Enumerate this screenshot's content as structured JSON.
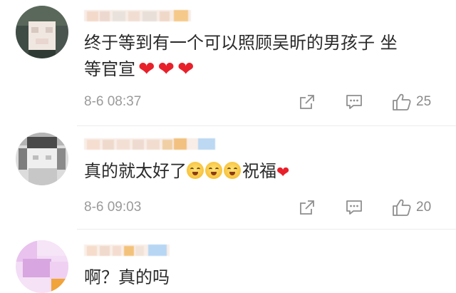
{
  "comments": [
    {
      "text_line1": "终于等到有一个可以照顾吴昕的男孩子 坐",
      "text_line2": "等官宣",
      "hearts": [
        "❤",
        "❤",
        "❤"
      ],
      "time": "8-6 08:37",
      "likes": "25",
      "avatar_colors": [
        "#5a6a5a",
        "#f1e8e2",
        "#3d4a44"
      ],
      "name_colors": [
        "#f3d9c9",
        "#e9e2dc",
        "#f5c98a"
      ]
    },
    {
      "text": "真的就太好了",
      "text_suffix": "祝福",
      "emoji_icons": [
        "grinning-sweat-emoji",
        "grinning-sweat-emoji",
        "grinning-sweat-emoji"
      ],
      "heart": "❤",
      "time": "8-6 09:03",
      "likes": "20",
      "avatar_colors": [
        "#9a9a9a",
        "#e6e6e6",
        "#4b4b4b"
      ],
      "name_colors": [
        "#f5ddd0",
        "#f2c17f",
        "#bcd8f2"
      ]
    },
    {
      "text": "啊？真的吗",
      "avatar_colors": [
        "#d8a6e0",
        "#f2d8f4",
        "#f0a43a"
      ],
      "name_colors": [
        "#f6dccb",
        "#f3c27a",
        "#b7d6f4"
      ]
    }
  ],
  "icons": {
    "share": "share-icon",
    "comment": "comment-icon",
    "like": "thumbs-up-icon"
  },
  "colors": {
    "text": "#2a2a2a",
    "meta": "#9a9a9a",
    "heart": "#e8202a",
    "divider": "#ececec"
  }
}
